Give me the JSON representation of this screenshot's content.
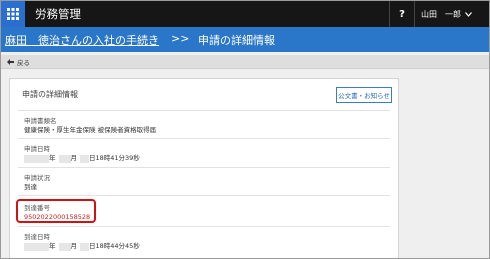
{
  "topbar": {
    "app_title": "労務管理",
    "help_label": "?",
    "user_name": "山田　一郎"
  },
  "breadcrumb": {
    "parent": "麻田　徳治さんの入社の手続き",
    "separator": ">>",
    "current": "申請の詳細情報"
  },
  "back": {
    "label": "戻る"
  },
  "card": {
    "title": "申請の詳細情報",
    "notice_button": "公文書・お知らせ",
    "fields": {
      "form_name": {
        "label": "申請書類名",
        "value": "健康保険・厚生年金保険 被保険者資格取得届"
      },
      "applied_at": {
        "label": "申請日時",
        "year_unit": "年",
        "month_unit": "月",
        "day_time": "日18時41分39秒"
      },
      "status": {
        "label": "申請状況",
        "value": "到達"
      },
      "arrival_no": {
        "label": "到達番号",
        "value": "9502022000158528"
      },
      "arrived_at": {
        "label": "到達日時",
        "year_unit": "年",
        "month_unit": "月",
        "day_time": "日18時44分45秒"
      }
    }
  },
  "colors": {
    "topbar_bg": "#161616",
    "accent_blue": "#2a77c9",
    "highlight_red": "#d21212"
  },
  "icons": [
    "app-grid-icon",
    "chevron-down-icon",
    "back-arrow-icon"
  ]
}
